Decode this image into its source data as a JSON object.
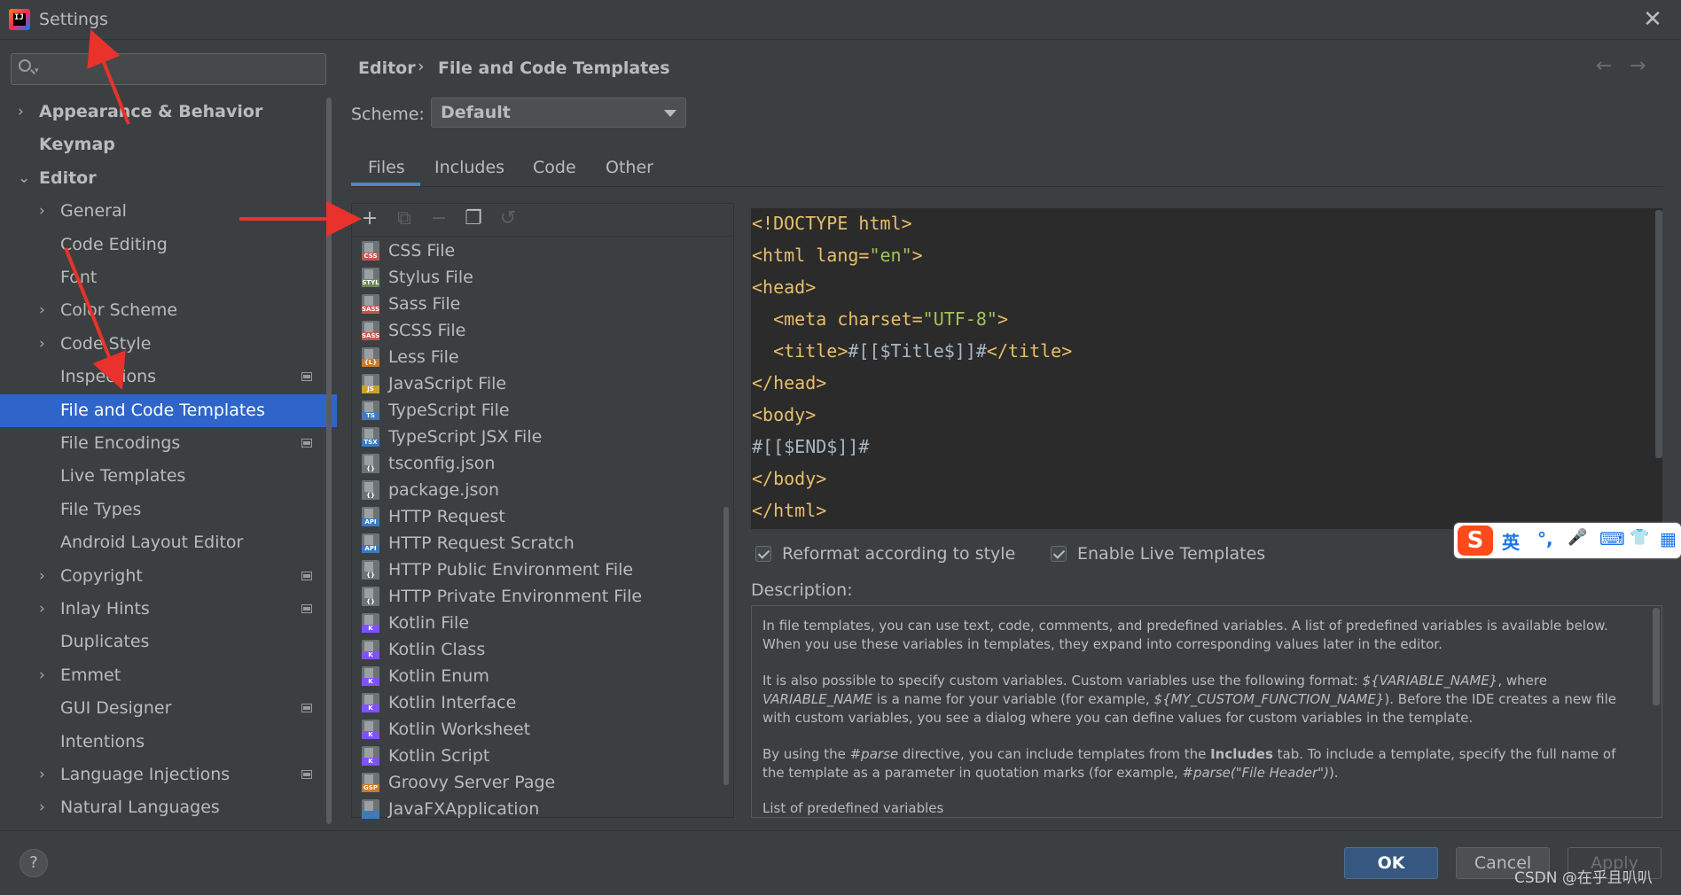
{
  "window": {
    "title": "Settings",
    "logo_text": "IJ",
    "close_glyph": "✕"
  },
  "search": {
    "placeholder": "",
    "dropdown_glyph": "▾"
  },
  "sidebar": {
    "items": [
      {
        "label": "Appearance & Behavior",
        "level": 0,
        "chevron": "›",
        "bold": true
      },
      {
        "label": "Keymap",
        "level": 0,
        "chevron": "",
        "bold": true
      },
      {
        "label": "Editor",
        "level": 0,
        "chevron": "⌄",
        "bold": true
      },
      {
        "label": "General",
        "level": 1,
        "chevron": "›"
      },
      {
        "label": "Code Editing",
        "level": 1,
        "chevron": ""
      },
      {
        "label": "Font",
        "level": 1,
        "chevron": ""
      },
      {
        "label": "Color Scheme",
        "level": 1,
        "chevron": "›"
      },
      {
        "label": "Code Style",
        "level": 1,
        "chevron": "›"
      },
      {
        "label": "Inspections",
        "level": 1,
        "chevron": "",
        "project": true
      },
      {
        "label": "File and Code Templates",
        "level": 1,
        "chevron": "",
        "selected": true
      },
      {
        "label": "File Encodings",
        "level": 1,
        "chevron": "",
        "project": true
      },
      {
        "label": "Live Templates",
        "level": 1,
        "chevron": ""
      },
      {
        "label": "File Types",
        "level": 1,
        "chevron": ""
      },
      {
        "label": "Android Layout Editor",
        "level": 1,
        "chevron": ""
      },
      {
        "label": "Copyright",
        "level": 1,
        "chevron": "›",
        "project": true
      },
      {
        "label": "Inlay Hints",
        "level": 1,
        "chevron": "›",
        "project": true
      },
      {
        "label": "Duplicates",
        "level": 1,
        "chevron": ""
      },
      {
        "label": "Emmet",
        "level": 1,
        "chevron": "›"
      },
      {
        "label": "GUI Designer",
        "level": 1,
        "chevron": "",
        "project": true
      },
      {
        "label": "Intentions",
        "level": 1,
        "chevron": ""
      },
      {
        "label": "Language Injections",
        "level": 1,
        "chevron": "›",
        "project": true
      },
      {
        "label": "Natural Languages",
        "level": 1,
        "chevron": "›"
      }
    ]
  },
  "breadcrumb": {
    "parent": "Editor",
    "separator": "›",
    "current": "File and Code Templates",
    "back_glyph": "←",
    "forward_glyph": "→"
  },
  "scheme": {
    "label": "Scheme:",
    "value": "Default"
  },
  "tabs": [
    "Files",
    "Includes",
    "Code",
    "Other"
  ],
  "toolbar": {
    "add": "+",
    "copy_disabled": "⧉",
    "remove": "−",
    "duplicate": "❐",
    "reset": "↺"
  },
  "files": [
    {
      "label": "CSS File",
      "badge": "CSS",
      "color": "#c75450"
    },
    {
      "label": "Stylus File",
      "badge": "STYL",
      "color": "#6a8759"
    },
    {
      "label": "Sass File",
      "badge": "SASS",
      "color": "#c75450"
    },
    {
      "label": "SCSS File",
      "badge": "SASS",
      "color": "#c75450"
    },
    {
      "label": "Less File",
      "badge": "{L}",
      "color": "#c97a2b"
    },
    {
      "label": "JavaScript File",
      "badge": "JS",
      "color": "#c9a32b"
    },
    {
      "label": "TypeScript File",
      "badge": "TS",
      "color": "#3d7bbf"
    },
    {
      "label": "TypeScript JSX File",
      "badge": "TSX",
      "color": "#3d7bbf"
    },
    {
      "label": "tsconfig.json",
      "badge": "{}",
      "color": "#6d7275"
    },
    {
      "label": "package.json",
      "badge": "{}",
      "color": "#6d7275"
    },
    {
      "label": "HTTP Request",
      "badge": "API",
      "color": "#3d7bbf"
    },
    {
      "label": "HTTP Request Scratch",
      "badge": "API",
      "color": "#3d7bbf"
    },
    {
      "label": "HTTP Public Environment File",
      "badge": "{}",
      "color": "#6d7275"
    },
    {
      "label": "HTTP Private Environment File",
      "badge": "{}",
      "color": "#6d7275"
    },
    {
      "label": "Kotlin File",
      "badge": "K",
      "color": "#7f52ff"
    },
    {
      "label": "Kotlin Class",
      "badge": "K",
      "color": "#7f52ff"
    },
    {
      "label": "Kotlin Enum",
      "badge": "K",
      "color": "#7f52ff"
    },
    {
      "label": "Kotlin Interface",
      "badge": "K",
      "color": "#7f52ff"
    },
    {
      "label": "Kotlin Worksheet",
      "badge": "K",
      "color": "#7f52ff"
    },
    {
      "label": "Kotlin Script",
      "badge": "K",
      "color": "#7f52ff"
    },
    {
      "label": "Groovy Server Page",
      "badge": "GSP",
      "color": "#c97a2b"
    },
    {
      "label": "JavaFXApplication",
      "badge": "",
      "color": "#3d7bbf"
    }
  ],
  "code": [
    [
      {
        "t": "<!DOCTYPE html>",
        "c": "tag"
      }
    ],
    [
      {
        "t": "<html lang=",
        "c": "tag"
      },
      {
        "t": "\"en\"",
        "c": "str"
      },
      {
        "t": ">",
        "c": "tag"
      }
    ],
    [
      {
        "t": "<head>",
        "c": "tag"
      }
    ],
    [
      {
        "t": "  <meta charset=",
        "c": "tag"
      },
      {
        "t": "\"UTF-8\"",
        "c": "str"
      },
      {
        "t": ">",
        "c": "tag"
      }
    ],
    [
      {
        "t": "  <title>",
        "c": "tag"
      },
      {
        "t": "#[[$Title$]]#",
        "c": "plain"
      },
      {
        "t": "</title>",
        "c": "tag"
      }
    ],
    [
      {
        "t": "</head>",
        "c": "tag"
      }
    ],
    [
      {
        "t": "<body>",
        "c": "tag"
      }
    ],
    [
      {
        "t": "#[[$END$]]#",
        "c": "plain"
      }
    ],
    [
      {
        "t": "</body>",
        "c": "tag"
      }
    ],
    [
      {
        "t": "</html>",
        "c": "tag"
      }
    ]
  ],
  "options": {
    "reformat": "Reformat according to style",
    "live_templates": "Enable Live Templates"
  },
  "description": {
    "label": "Description:",
    "p1": "In file templates, you can use text, code, comments, and predefined variables. A list of predefined variables is available below. When you use these variables in templates, they expand into corresponding values later in the editor.",
    "p2a": "It is also possible to specify custom variables. Custom variables use the following format: ",
    "p2b": "${VARIABLE_NAME}",
    "p2c": ", where ",
    "p2d": "VARIABLE_NAME",
    "p2e": " is a name for your variable (for example, ",
    "p2f": "${MY_CUSTOM_FUNCTION_NAME}",
    "p2g": "). Before the IDE creates a new file with custom variables, you see a dialog where you can define values for custom variables in the template.",
    "p3a": "By using the ",
    "p3b": "#parse",
    "p3c": " directive, you can include templates from the ",
    "p3d": "Includes",
    "p3e": " tab. To include a template, specify the full name of the template as a parameter in quotation marks (for example, ",
    "p3f": "#parse(\"File Header\")",
    "p3g": ").",
    "p4": "List of predefined variables"
  },
  "buttons": {
    "help": "?",
    "ok": "OK",
    "cancel": "Cancel",
    "apply": "Apply"
  },
  "ime": {
    "logo": "S",
    "lang": "英",
    "punct": "°,",
    "mic": "🎤",
    "keyboard": "⌨",
    "skin": "👕",
    "grid": "▦"
  },
  "watermark": "CSDN @在乎且叭叭",
  "colors": {
    "accent": "#2f65ca",
    "ok_button": "#365880",
    "arrow": "#e8322b"
  }
}
